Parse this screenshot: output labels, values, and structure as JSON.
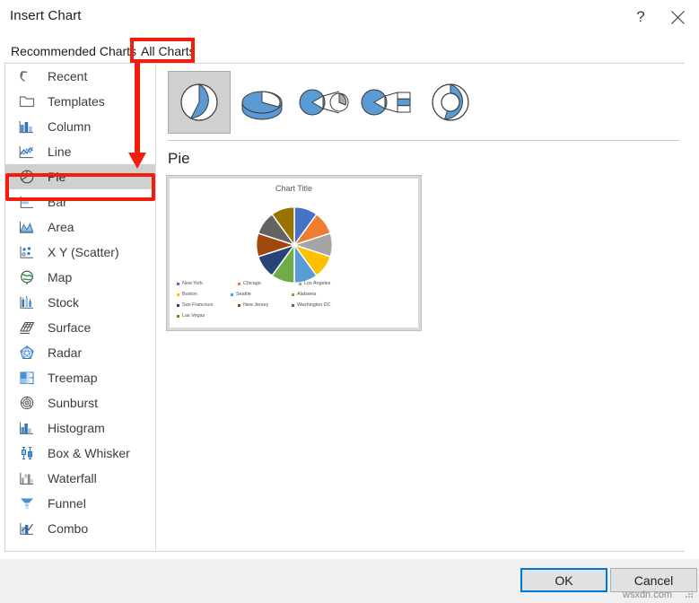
{
  "dialog": {
    "title": "Insert Chart",
    "help_icon": "question-mark-icon",
    "close_icon": "close-icon"
  },
  "tabs": [
    {
      "label": "Recommended Charts",
      "selected": false
    },
    {
      "label": "All Charts",
      "selected": true
    }
  ],
  "sidebar": {
    "items": [
      {
        "label": "Recent",
        "icon": "undo-arrow-icon",
        "selected": false
      },
      {
        "label": "Templates",
        "icon": "folder-icon",
        "selected": false
      },
      {
        "label": "Column",
        "icon": "column-chart-icon",
        "selected": false
      },
      {
        "label": "Line",
        "icon": "line-chart-icon",
        "selected": false
      },
      {
        "label": "Pie",
        "icon": "pie-chart-icon",
        "selected": true
      },
      {
        "label": "Bar",
        "icon": "bar-chart-icon",
        "selected": false
      },
      {
        "label": "Area",
        "icon": "area-chart-icon",
        "selected": false
      },
      {
        "label": "X Y (Scatter)",
        "icon": "scatter-chart-icon",
        "selected": false
      },
      {
        "label": "Map",
        "icon": "globe-map-icon",
        "selected": false
      },
      {
        "label": "Stock",
        "icon": "stock-chart-icon",
        "selected": false
      },
      {
        "label": "Surface",
        "icon": "surface-chart-icon",
        "selected": false
      },
      {
        "label": "Radar",
        "icon": "radar-chart-icon",
        "selected": false
      },
      {
        "label": "Treemap",
        "icon": "treemap-chart-icon",
        "selected": false
      },
      {
        "label": "Sunburst",
        "icon": "sunburst-chart-icon",
        "selected": false
      },
      {
        "label": "Histogram",
        "icon": "histogram-chart-icon",
        "selected": false
      },
      {
        "label": "Box & Whisker",
        "icon": "box-whisker-chart-icon",
        "selected": false
      },
      {
        "label": "Waterfall",
        "icon": "waterfall-chart-icon",
        "selected": false
      },
      {
        "label": "Funnel",
        "icon": "funnel-chart-icon",
        "selected": false
      },
      {
        "label": "Combo",
        "icon": "combo-chart-icon",
        "selected": false
      }
    ]
  },
  "subtypes": {
    "items": [
      {
        "name": "Pie",
        "icon": "pie-subtype-icon",
        "selected": true
      },
      {
        "name": "3-D Pie",
        "icon": "pie-3d-subtype-icon",
        "selected": false
      },
      {
        "name": "Pie of Pie",
        "icon": "pie-of-pie-subtype-icon",
        "selected": false
      },
      {
        "name": "Bar of Pie",
        "icon": "bar-of-pie-subtype-icon",
        "selected": false
      },
      {
        "name": "Doughnut",
        "icon": "doughnut-subtype-icon",
        "selected": false
      }
    ]
  },
  "preview": {
    "heading": "Pie"
  },
  "chart_data": {
    "type": "pie",
    "title": "Chart Title",
    "xlabel": "",
    "ylabel": "",
    "legend_position": "bottom",
    "grid": false,
    "categories": [
      "New York",
      "Chicago",
      "Los Angeles",
      "Boston",
      "Seattle",
      "Alabama",
      "San Francisco",
      "New Jersey",
      "Washington DC",
      "Las Vegas"
    ],
    "values": [
      10,
      10,
      10,
      10,
      10,
      10,
      10,
      10,
      10,
      10
    ],
    "colors": [
      "#4472c4",
      "#ed7d31",
      "#a5a5a5",
      "#ffc000",
      "#5b9bd5",
      "#70ad47",
      "#264478",
      "#9e480e",
      "#636363",
      "#997300"
    ]
  },
  "footer": {
    "ok_label": "OK",
    "cancel_label": "Cancel",
    "watermark": "wsxdn.com"
  },
  "annotations": {
    "tab_highlight_color": "#f41c0c",
    "pie_highlight_color": "#f41c0c",
    "arrow_color": "#f41c0c"
  }
}
